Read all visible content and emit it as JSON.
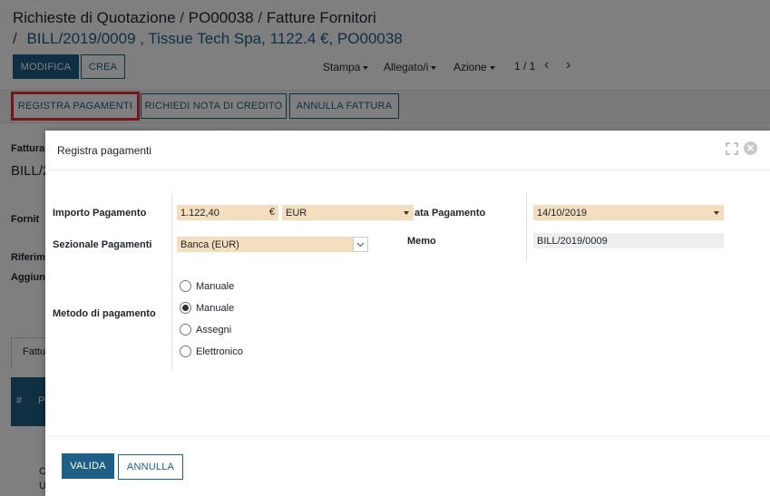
{
  "breadcrumb": {
    "items": [
      "Richieste di Quotazione",
      "PO00038",
      "Fatture Fornitori"
    ],
    "separator": "/",
    "current": "BILL/2019/0009 , Tissue Tech Spa, 1122.4 €, PO00038"
  },
  "toolbar": {
    "modifica_label": "MODIFICA",
    "crea_label": "CREA",
    "stampa_label": "Stampa",
    "allegati_label": "Allegato/i",
    "azione_label": "Azione",
    "pager": "1 / 1",
    "prev_icon": "chevron-left-icon",
    "next_icon": "chevron-right-icon"
  },
  "statusbar": {
    "registra_label": "REGISTRA PAGAMENTI",
    "nota_credito_label": "RICHIEDI NOTA DI CREDITO",
    "annulla_fattura_label": "ANNULLA FATTURA"
  },
  "background_form": {
    "fattura_label": "Fattura",
    "bill_partial": "BILL/2",
    "fornitore_label": "Fornit",
    "riferimento_label": "Riferim",
    "aggiungi_label": "Aggiun",
    "tab_label": "Fattu",
    "col_hash": "#",
    "col_p": "P",
    "row_c": "C",
    "row_u": "U"
  },
  "modal": {
    "title": "Registra pagamenti",
    "expand_icon": "expand-icon",
    "close_icon": "close-icon",
    "importo_label": "Importo Pagamento",
    "importo_value": "1.122,40",
    "currency_symbol": "€",
    "currency_value": "EUR",
    "sezionale_label": "Sezionale Pagamenti",
    "sezionale_value": "Banca (EUR)",
    "data_label": "ata Pagamento",
    "data_value": "14/10/2019",
    "memo_label": "Memo",
    "memo_value": "BILL/2019/0009",
    "metodo_label": "Metodo di pagamento",
    "metodo_options": [
      {
        "label": "Manuale",
        "selected": false
      },
      {
        "label": "Manuale",
        "selected": true
      },
      {
        "label": "Assegni",
        "selected": false
      },
      {
        "label": "Elettronico",
        "selected": false
      }
    ],
    "valida_label": "VALIDA",
    "annulla_label": "ANNULLA"
  },
  "colors": {
    "primary": "#1f5f86",
    "required_field": "#f3dfbf",
    "highlight": "#e0303a"
  }
}
